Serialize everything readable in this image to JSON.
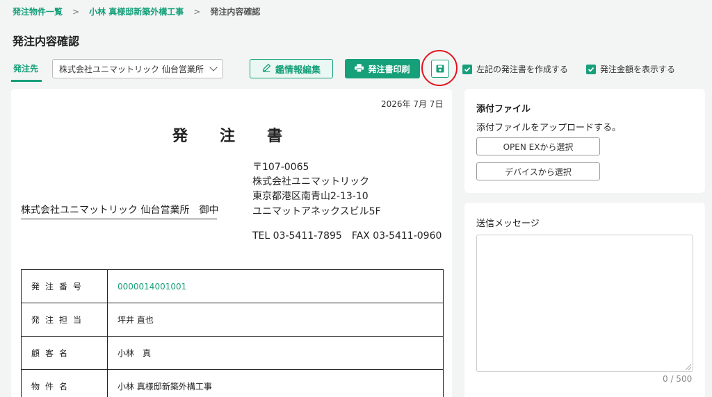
{
  "breadcrumb": {
    "items": [
      "発注物件一覧",
      "小林 真様邸新築外構工事"
    ],
    "separator": ">",
    "current": "発注内容確認"
  },
  "page_title": "発注内容確認",
  "toolbar": {
    "tab_label": "発注先",
    "supplier_select": "株式会社ユニマットリック 仙台営業所",
    "edit_button": "鑑情報編集",
    "print_button": "発注書印刷",
    "check_create": "左記の発注書を作成する",
    "check_show_amount": "発注金額を表示する"
  },
  "document": {
    "date": "2026年 7月 7日",
    "title": "発注書",
    "sender": {
      "postal": "〒107-0065",
      "company": "株式会社ユニマットリック",
      "address": "東京都港区南青山2-13-10",
      "building": "ユニマットアネックスビル5F",
      "tel_fax": "TEL 03-5411-7895　FAX 03-5411-0960"
    },
    "recipient": "株式会社ユニマットリック 仙台営業所　御中",
    "table": [
      {
        "key": "発注番号",
        "value": "0000014001001"
      },
      {
        "key": "発注担当",
        "value": "坪井 直也"
      },
      {
        "key": "顧客名",
        "value": "小林　真"
      },
      {
        "key": "物件名",
        "value": "小林 真様邸新築外構工事"
      }
    ]
  },
  "attachments": {
    "title": "添付ファイル",
    "description": "添付ファイルをアップロードする。",
    "btn_openex": "OPEN EXから選択",
    "btn_device": "デバイスから選択"
  },
  "message": {
    "label": "送信メッセージ",
    "value": "",
    "counter": "0 / 500"
  },
  "colors": {
    "accent": "#16a07a",
    "highlight_circle": "#e0151b"
  }
}
